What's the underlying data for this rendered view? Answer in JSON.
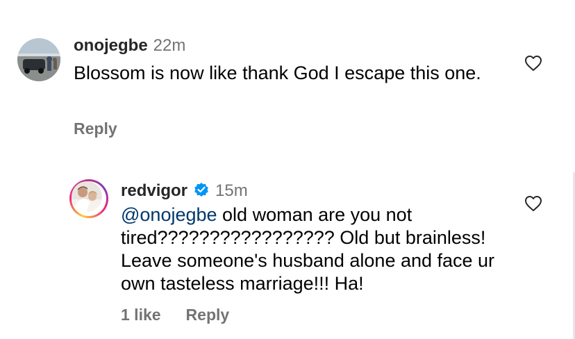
{
  "comments": [
    {
      "username": "onojegbe",
      "time": "22m",
      "text": "Blossom is now like thank God I escape this one.",
      "actions": {
        "reply": "Reply"
      },
      "avatar_icon": "profile-photo-car-crowd"
    },
    {
      "username": "redvigor",
      "verified": true,
      "time": "15m",
      "mention": "@onojegbe",
      "text": " old woman are you not tired????????????????? Old but brainless! Leave someone's husband alone and face ur own tasteless marriage!!! Ha!",
      "actions": {
        "likes": "1 like",
        "reply": "Reply"
      },
      "avatar_icon": "profile-photo-person-story-ring"
    }
  ],
  "colors": {
    "username": "#262626",
    "secondary": "#737373",
    "mention": "#00376b",
    "verified": "#0095f6"
  },
  "icons": {
    "like": "heart-outline-icon",
    "verified": "verified-badge-icon"
  }
}
